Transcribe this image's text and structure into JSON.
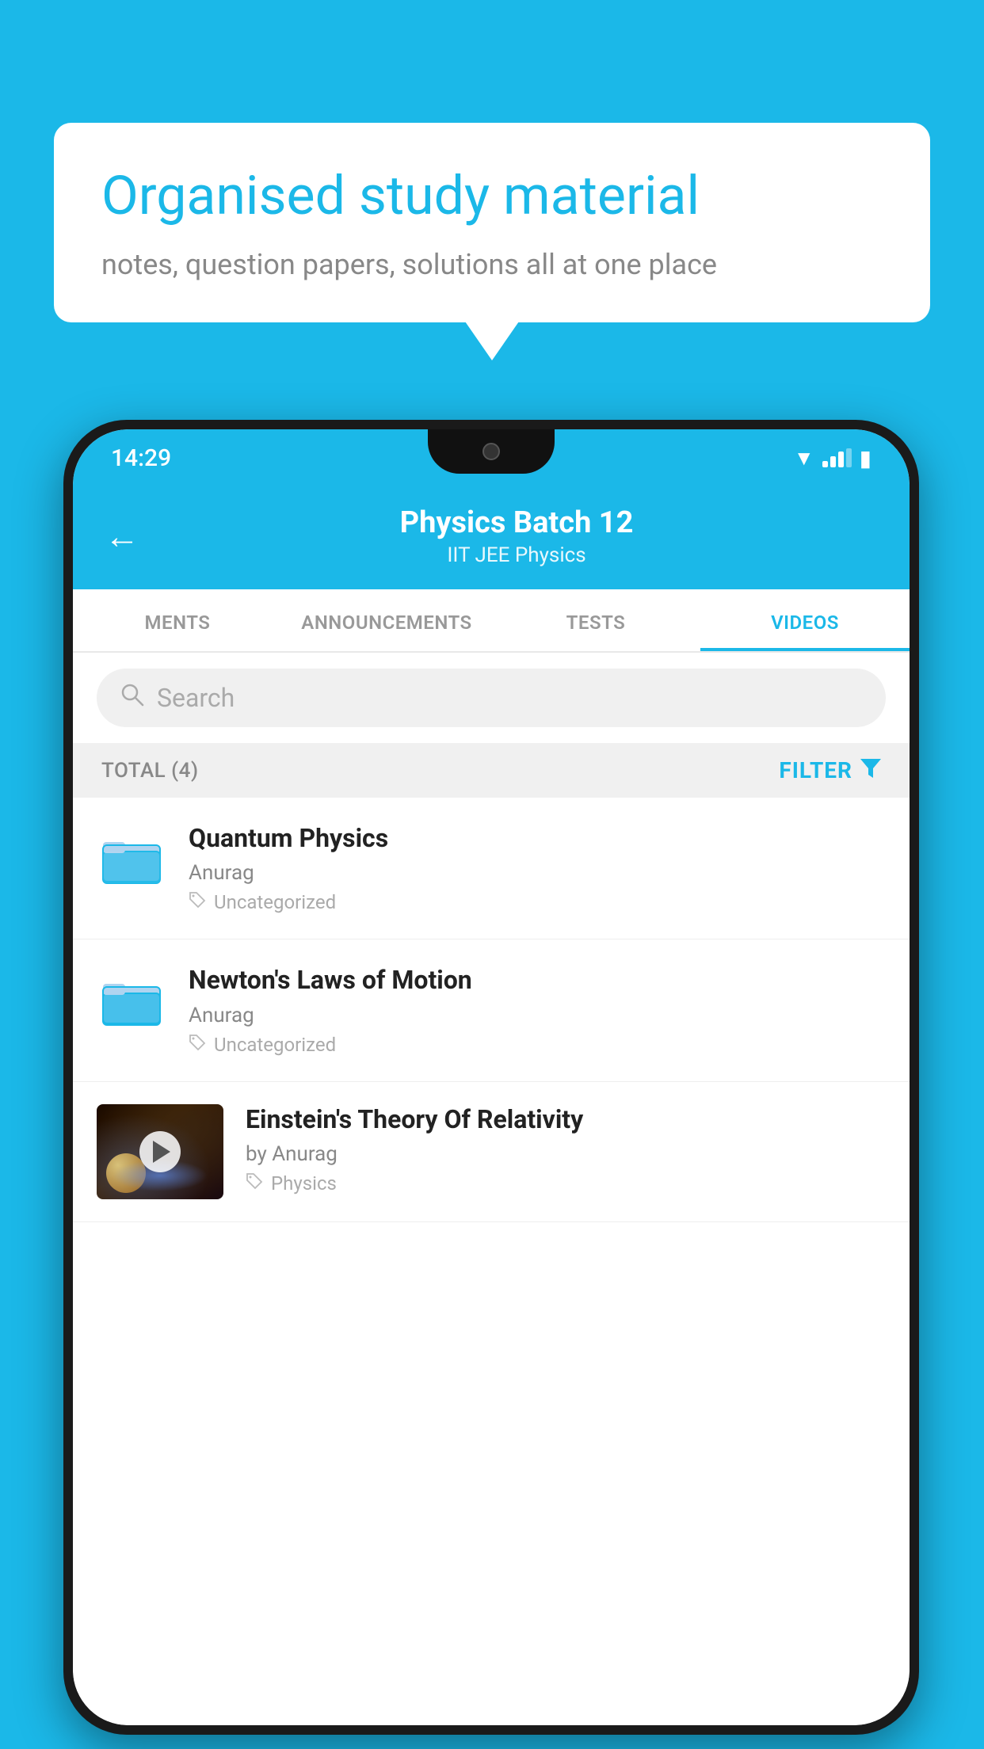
{
  "background_color": "#1bb8e8",
  "speech_bubble": {
    "title": "Organised study material",
    "subtitle": "notes, question papers, solutions all at one place"
  },
  "status_bar": {
    "time": "14:29"
  },
  "app_header": {
    "title": "Physics Batch 12",
    "subtitle": "IIT JEE    Physics",
    "back_label": "←"
  },
  "tabs": [
    {
      "label": "MENTS",
      "active": false
    },
    {
      "label": "ANNOUNCEMENTS",
      "active": false
    },
    {
      "label": "TESTS",
      "active": false
    },
    {
      "label": "VIDEOS",
      "active": true
    }
  ],
  "search": {
    "placeholder": "Search"
  },
  "filter_bar": {
    "total_label": "TOTAL (4)",
    "filter_label": "FILTER"
  },
  "videos": [
    {
      "id": 1,
      "title": "Quantum Physics",
      "author": "Anurag",
      "tag": "Uncategorized",
      "has_thumb": false
    },
    {
      "id": 2,
      "title": "Newton's Laws of Motion",
      "author": "Anurag",
      "tag": "Uncategorized",
      "has_thumb": false
    },
    {
      "id": 3,
      "title": "Einstein's Theory Of Relativity",
      "author": "by Anurag",
      "tag": "Physics",
      "has_thumb": true
    }
  ]
}
